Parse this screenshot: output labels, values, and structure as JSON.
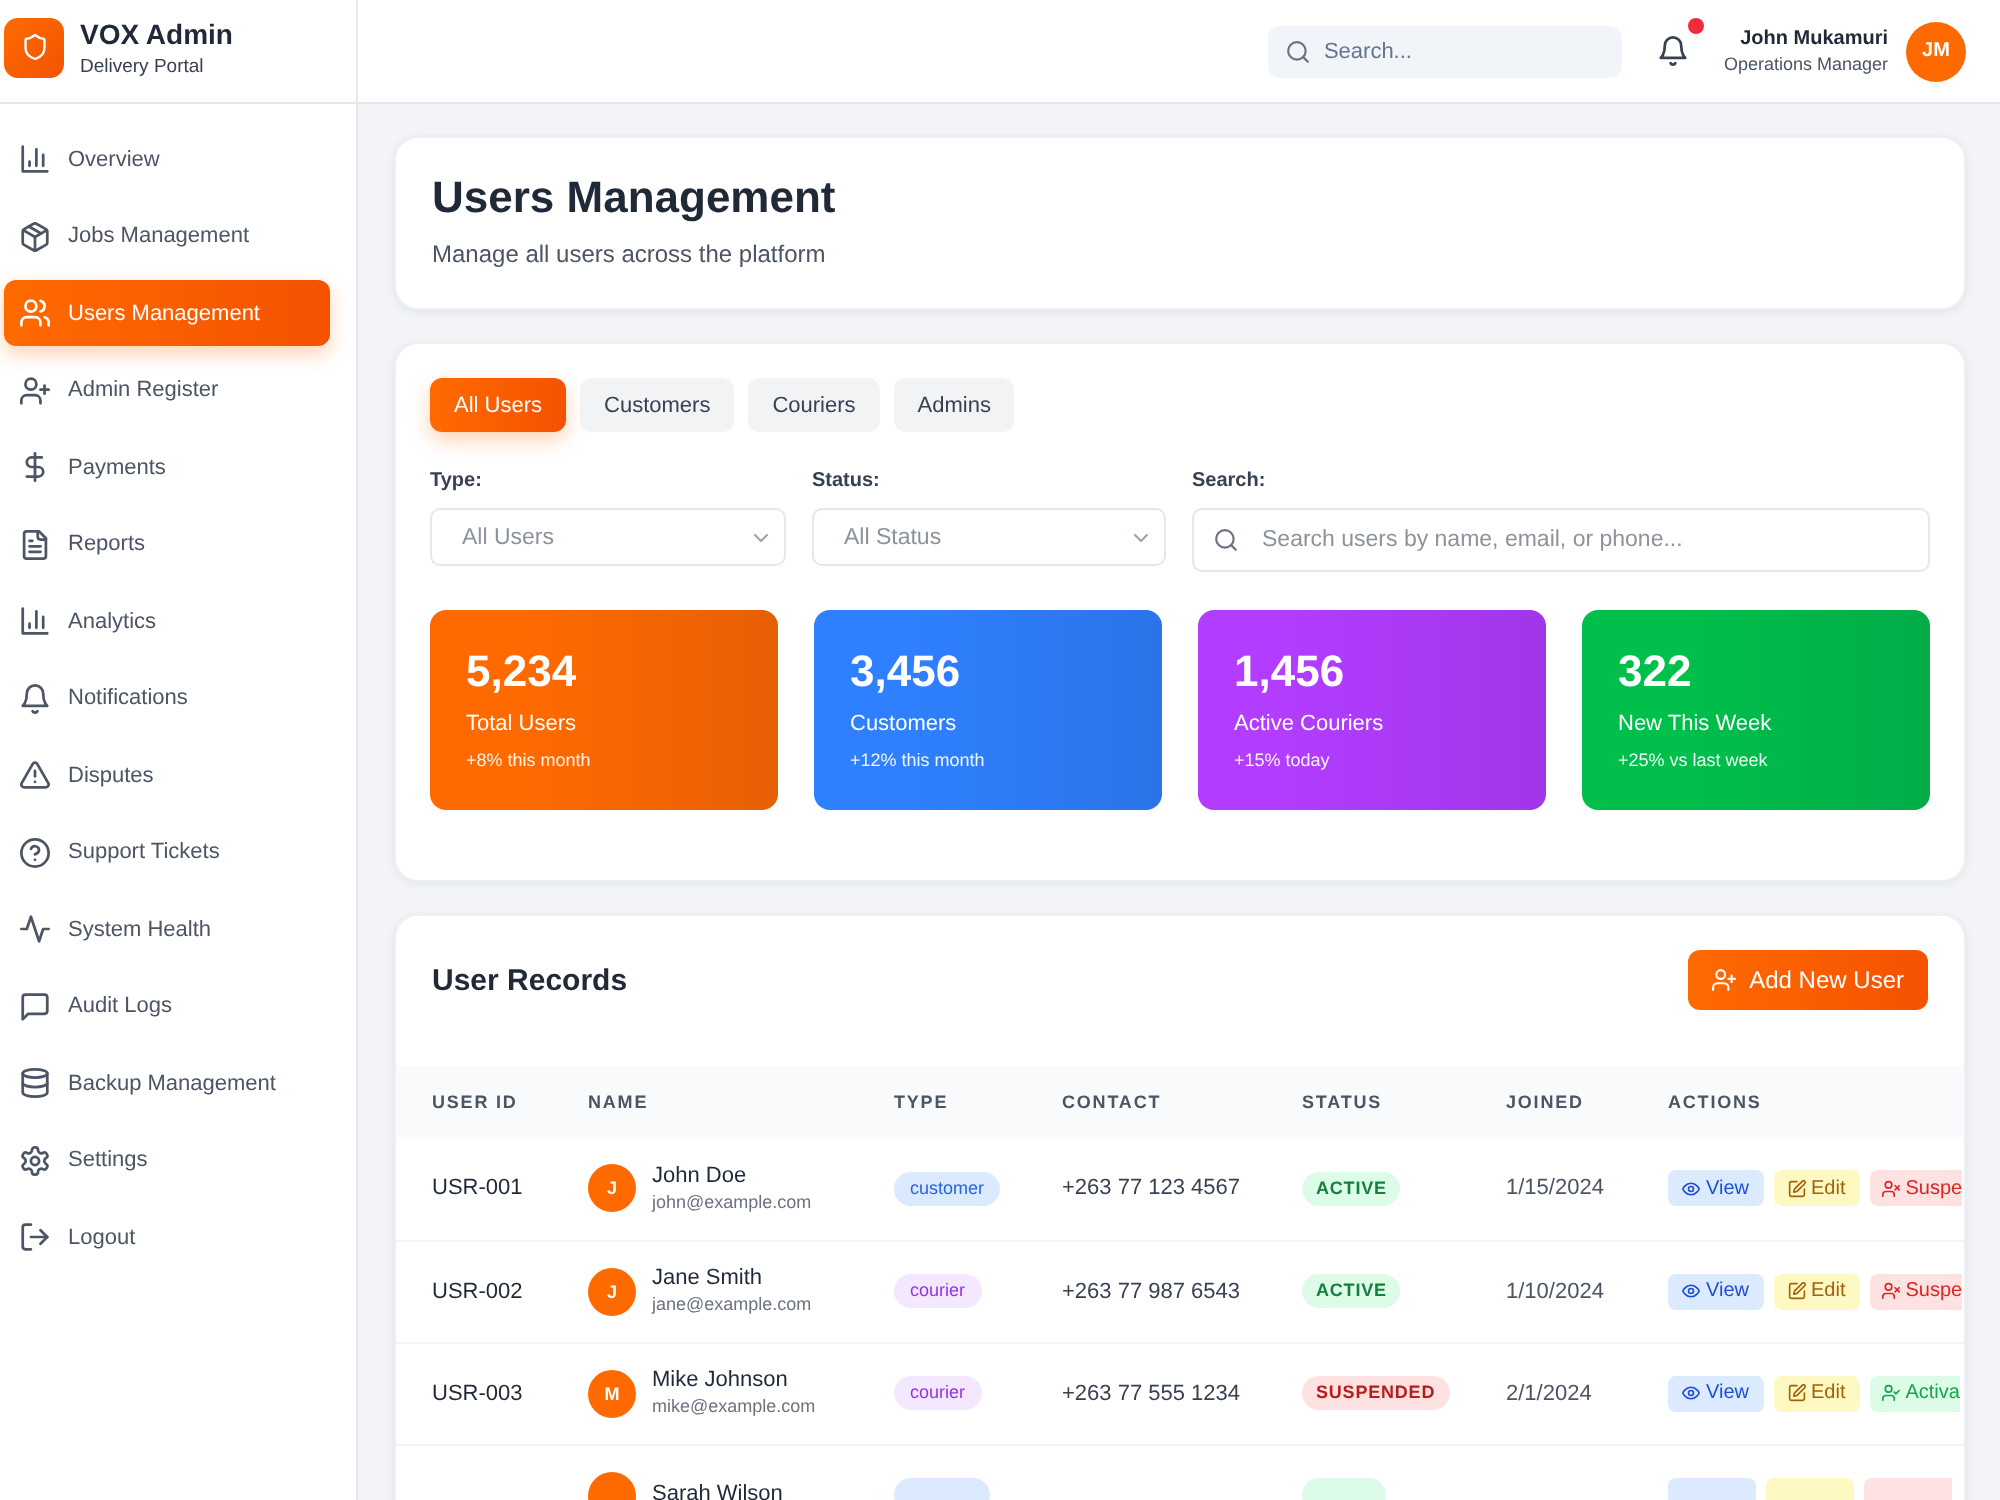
{
  "brand": {
    "title": "VOX Admin",
    "subtitle": "Delivery Portal"
  },
  "sidebar": {
    "items": [
      {
        "label": "Overview",
        "selected": false
      },
      {
        "label": "Jobs Management",
        "selected": false
      },
      {
        "label": "Users Management",
        "selected": true
      },
      {
        "label": "Admin Register",
        "selected": false
      },
      {
        "label": "Payments",
        "selected": false
      },
      {
        "label": "Reports",
        "selected": false
      },
      {
        "label": "Analytics",
        "selected": false
      },
      {
        "label": "Notifications",
        "selected": false
      },
      {
        "label": "Disputes",
        "selected": false
      },
      {
        "label": "Support Tickets",
        "selected": false
      },
      {
        "label": "System Health",
        "selected": false
      },
      {
        "label": "Audit Logs",
        "selected": false
      },
      {
        "label": "Backup Management",
        "selected": false
      },
      {
        "label": "Settings",
        "selected": false
      },
      {
        "label": "Logout",
        "selected": false
      }
    ]
  },
  "header": {
    "search": {
      "placeholder": "Search..."
    },
    "notifications": {
      "unread": true
    },
    "user": {
      "name": "John Mukamuri",
      "role": "Operations Manager",
      "initials": "JM"
    }
  },
  "page": {
    "title": "Users Management",
    "subtitle": "Manage all users across the platform"
  },
  "tabs": [
    {
      "label": "All Users",
      "selected": true
    },
    {
      "label": "Customers",
      "selected": false
    },
    {
      "label": "Couriers",
      "selected": false
    },
    {
      "label": "Admins",
      "selected": false
    }
  ],
  "filters": [
    {
      "kind": "select",
      "label": "Type:",
      "value": "All Users"
    },
    {
      "kind": "select",
      "label": "Status:",
      "value": "All Status"
    },
    {
      "kind": "search",
      "label": "Search:",
      "placeholder": "Search users by name, email, or phone..."
    }
  ],
  "stats": [
    {
      "value": "5,234",
      "label": "Total Users",
      "note": "+8% this month",
      "color": "#ff6a00"
    },
    {
      "value": "3,456",
      "label": "Customers",
      "note": "+12% this month",
      "color": "#2f80ff"
    },
    {
      "value": "1,456",
      "label": "Active Couriers",
      "note": "+15% today",
      "color": "#b23cff"
    },
    {
      "value": "322",
      "label": "New This Week",
      "note": "+25% vs last week",
      "color": "#00c04b"
    }
  ],
  "table": {
    "title": "User Records",
    "add_button": "Add New User",
    "columns": [
      "USER ID",
      "NAME",
      "TYPE",
      "CONTACT",
      "STATUS",
      "JOINED",
      "ACTIONS"
    ],
    "rows": [
      {
        "id": "USR-001",
        "initial": "J",
        "name": "John Doe",
        "email": "john@example.com",
        "type": {
          "label": "customer",
          "kind": "customer"
        },
        "contact": "+263 77 123 4567",
        "status": {
          "label": "ACTIVE",
          "kind": "active"
        },
        "joined": "1/15/2024",
        "actions": [
          {
            "label": "View",
            "kind": "view"
          },
          {
            "label": "Edit",
            "kind": "edit"
          },
          {
            "label": "Suspe",
            "kind": "suspend"
          }
        ]
      },
      {
        "id": "USR-002",
        "initial": "J",
        "name": "Jane Smith",
        "email": "jane@example.com",
        "type": {
          "label": "courier",
          "kind": "courier"
        },
        "contact": "+263 77 987 6543",
        "status": {
          "label": "ACTIVE",
          "kind": "active"
        },
        "joined": "1/10/2024",
        "actions": [
          {
            "label": "View",
            "kind": "view"
          },
          {
            "label": "Edit",
            "kind": "edit"
          },
          {
            "label": "Suspe",
            "kind": "suspend"
          }
        ]
      },
      {
        "id": "USR-003",
        "initial": "M",
        "name": "Mike Johnson",
        "email": "mike@example.com",
        "type": {
          "label": "courier",
          "kind": "courier"
        },
        "contact": "+263 77 555 1234",
        "status": {
          "label": "SUSPENDED",
          "kind": "suspended"
        },
        "joined": "2/1/2024",
        "actions": [
          {
            "label": "View",
            "kind": "view"
          },
          {
            "label": "Edit",
            "kind": "edit"
          },
          {
            "label": "Activa",
            "kind": "activate"
          }
        ]
      },
      {
        "name": "Sarah Wilson",
        "type": {
          "kind": "customer"
        },
        "status": {
          "kind": "active"
        },
        "actions": [
          {
            "kind": "view"
          },
          {
            "kind": "edit"
          },
          {
            "kind": "suspend"
          }
        ]
      }
    ]
  }
}
